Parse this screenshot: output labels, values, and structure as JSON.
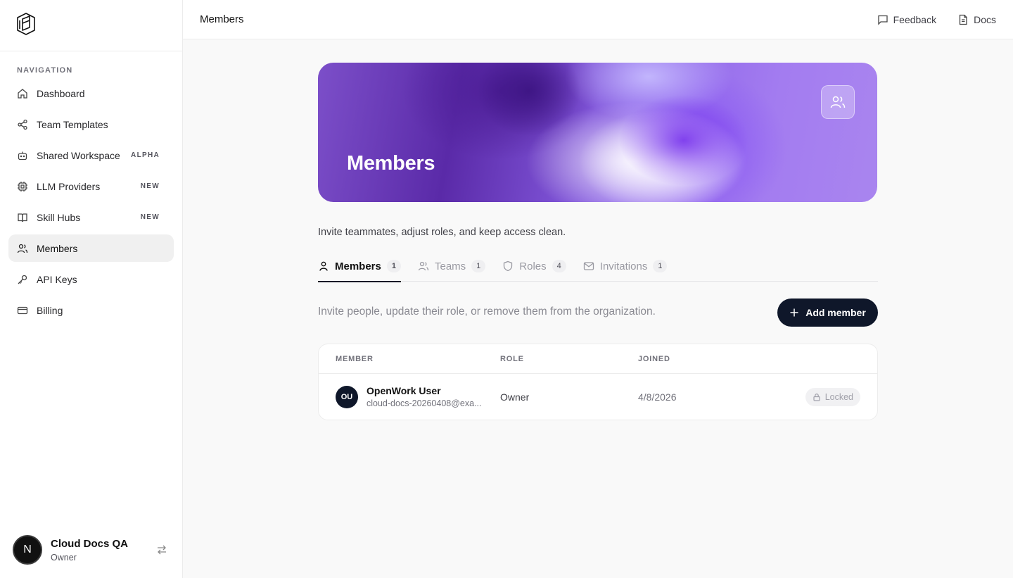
{
  "sidebar": {
    "section_heading": "NAVIGATION",
    "items": [
      {
        "label": "Dashboard",
        "icon": "home-icon",
        "badge": ""
      },
      {
        "label": "Team Templates",
        "icon": "share-icon",
        "badge": ""
      },
      {
        "label": "Shared Workspace",
        "icon": "bot-icon",
        "badge": "ALPHA"
      },
      {
        "label": "LLM Providers",
        "icon": "cpu-icon",
        "badge": "NEW"
      },
      {
        "label": "Skill Hubs",
        "icon": "book-icon",
        "badge": "NEW"
      },
      {
        "label": "Members",
        "icon": "users-icon",
        "badge": "",
        "active": true
      },
      {
        "label": "API Keys",
        "icon": "key-icon",
        "badge": ""
      },
      {
        "label": "Billing",
        "icon": "credit-card-icon",
        "badge": ""
      }
    ],
    "account": {
      "avatar_letter": "N",
      "name": "Cloud Docs QA",
      "role": "Owner"
    }
  },
  "topbar": {
    "title": "Members",
    "links": [
      {
        "label": "Feedback",
        "icon": "message-square-icon"
      },
      {
        "label": "Docs",
        "icon": "file-text-icon"
      }
    ]
  },
  "hero": {
    "title": "Members",
    "icon": "users-icon"
  },
  "subtitle": "Invite teammates, adjust roles, and keep access clean.",
  "tabs": [
    {
      "label": "Members",
      "count": "1",
      "icon": "user-icon",
      "active": true
    },
    {
      "label": "Teams",
      "count": "1",
      "icon": "users-icon"
    },
    {
      "label": "Roles",
      "count": "4",
      "icon": "shield-icon"
    },
    {
      "label": "Invitations",
      "count": "1",
      "icon": "mail-icon"
    }
  ],
  "members_panel": {
    "description": "Invite people, update their role, or remove them from the organization.",
    "add_button_label": "Add member",
    "columns": [
      "MEMBER",
      "ROLE",
      "JOINED"
    ],
    "rows": [
      {
        "initials": "OU",
        "name": "OpenWork User",
        "email": "cloud-docs-20260408@exa...",
        "role": "Owner",
        "joined": "4/8/2026",
        "status": "Locked"
      }
    ]
  },
  "colors": {
    "accent_dark": "#0f172a",
    "hero_purple": "#7c3aed",
    "active_nav_bg": "#f0f0f0"
  }
}
